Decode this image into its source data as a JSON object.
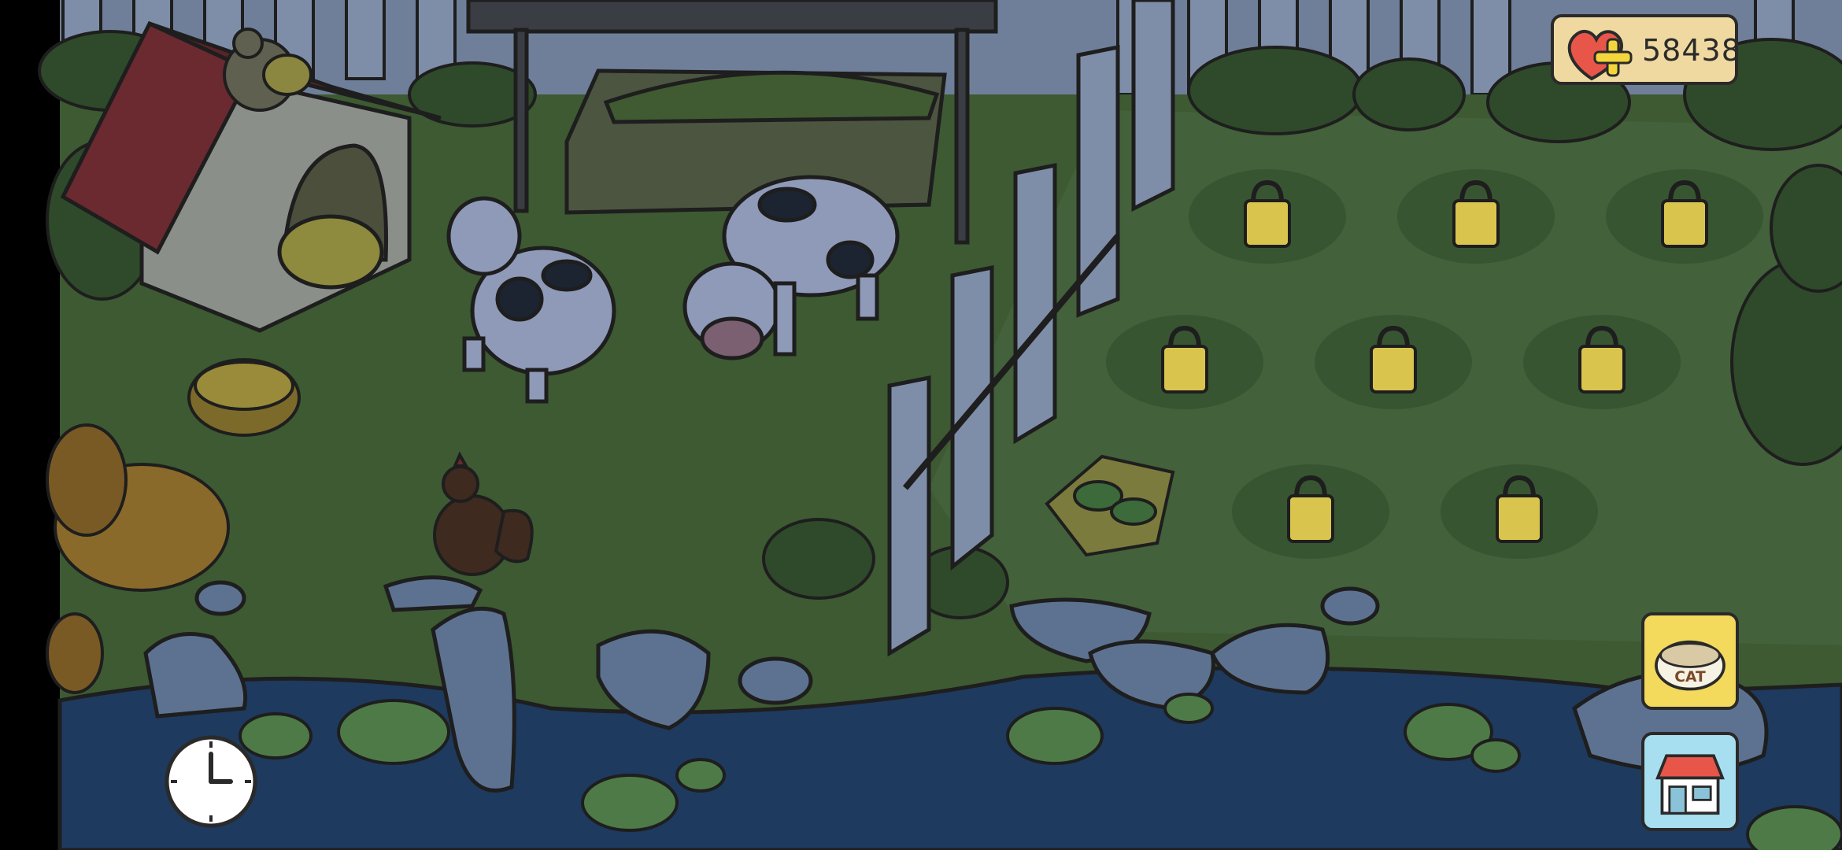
{
  "hud": {
    "currency": {
      "value": "58438",
      "icon": "heart-plus-icon"
    },
    "cat_food_button": {
      "label": "CAT",
      "icon": "cat-food-bowl-icon"
    },
    "shop_button": {
      "icon": "shop-icon"
    },
    "clock_button": {
      "icon": "clock-icon"
    }
  },
  "scene": {
    "locked_plots": 8,
    "colors": {
      "grass": "#3d5a32",
      "grass_dark": "#324b29",
      "fence": "#7f8ea8",
      "water": "#1e3a5e",
      "rock": "#5d7290",
      "lily_pad": "#4e7a48",
      "lock": "#d9c44e",
      "coin_panel": "#efd9a0",
      "cat_button": "#f3d95c",
      "shop_button": "#a8dff0"
    }
  }
}
